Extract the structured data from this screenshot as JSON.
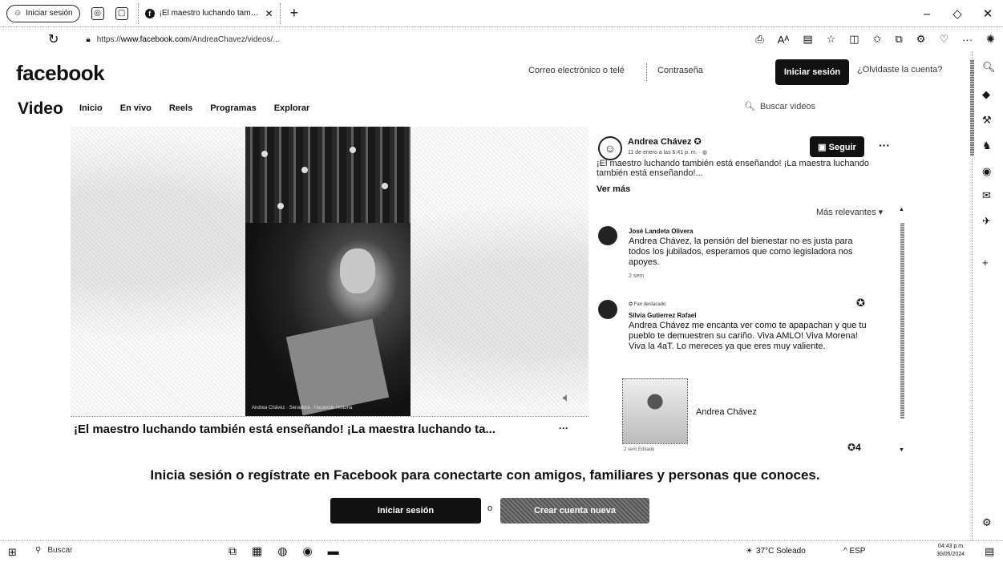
{
  "browser": {
    "profile_label": "Iniciar sesión",
    "tab_title": "¡El maestro luchando también e",
    "tab_close": "✕",
    "new_tab": "+",
    "window_controls": [
      "–",
      "◇",
      "✕"
    ],
    "url_prefix": "https://",
    "url_domain": "www.facebook.com",
    "url_path": "/AndreaChavez/videos/...",
    "tool_icons": [
      "read-aloud-icon",
      "text-size-icon",
      "reader-icon",
      "favorite-icon",
      "split-screen-icon",
      "favorites-bar-icon",
      "collections-icon",
      "extensions-icon",
      "more-icon",
      "copilot-icon"
    ]
  },
  "fbnav": {
    "logo": "facebook",
    "email_placeholder": "Correo electrónico o telé",
    "password_placeholder": "Contraseña",
    "login_label": "Iniciar sesión",
    "forgot_label": "¿Olvidaste la cuenta?"
  },
  "videonav": {
    "title": "Video",
    "links": [
      "Inicio",
      "En vivo",
      "Reels",
      "Programas",
      "Explorar"
    ],
    "search_placeholder": "Buscar videos"
  },
  "video": {
    "overlay_caption": "Andrea Chávez · Senadora · Haciendo Historia",
    "caption": "¡El maestro luchando también está enseñando! ¡La maestra luchando ta...",
    "more": "···"
  },
  "post": {
    "author": "Andrea Chávez",
    "verified": "✪",
    "date": "11 de enero a las 6:41 p. m. · ",
    "follow_label": "Seguir",
    "more": "···",
    "text": "¡El maestro luchando también está enseñando! ¡La maestra luchando también está enseñando!...",
    "see_more": "Ver más",
    "sort_label": "Más relevantes ▾"
  },
  "comments": [
    {
      "badge": "",
      "name": "José Landeta Olivera",
      "text": "Andrea Chávez, la pensión del bienestar no es justa para todos los jubilados, esperamos que como legisladora nos apoyes.",
      "time": "2 sem"
    },
    {
      "badge": "✪ Fan destacado",
      "name": "Silvia Gutierrez Rafael",
      "text": "Andrea Chávez me encanta ver como te apapachan y que tu pueblo te demuestren su cariño. Viva AMLO! Viva Morena! Viva la 4aT. Lo mereces ya que eres muy valiente.",
      "time": ""
    }
  ],
  "shared": {
    "name": "Andrea Chávez",
    "meta": "2 sem   Editado",
    "likes": "4"
  },
  "prompt": {
    "text": "Inicia sesión o regístrate en Facebook para conectarte con amigos, familiares y personas que conoces.",
    "login_label": "Iniciar sesión",
    "or": "o",
    "create_label": "Crear cuenta nueva"
  },
  "taskbar": {
    "search_label": "Buscar",
    "weather": "37°C  Soleado",
    "tray": "^  ESP",
    "time": "04:43 p.m.",
    "date": "30/05/2024"
  },
  "colors": {
    "primary_button": "#111111",
    "text": "#111111",
    "muted": "#444444"
  }
}
